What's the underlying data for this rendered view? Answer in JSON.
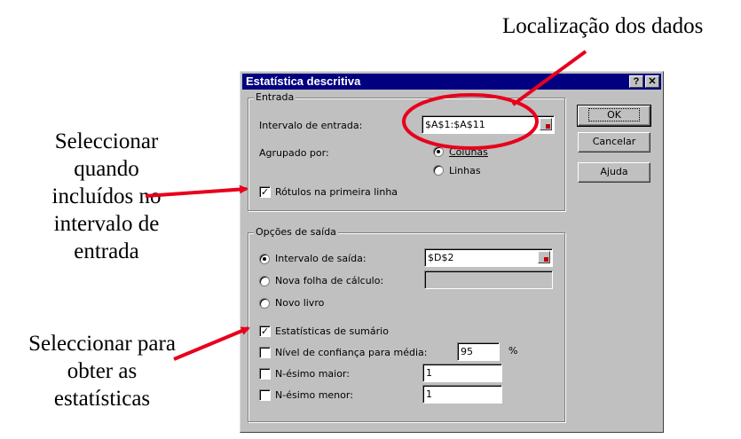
{
  "annotations": {
    "data_location": "Localização dos dados",
    "select_labels": [
      "Seleccionar",
      "quando",
      "incluídos no",
      "intervalo de",
      "entrada"
    ],
    "select_stats": [
      "Seleccionar para",
      "obter as",
      "estatísticas"
    ]
  },
  "dialog": {
    "title": "Estatística descritiva",
    "help_button": "?",
    "close_button": "✕",
    "input_group": {
      "label": "Entrada",
      "range_label": "Intervalo de entrada:",
      "range_value": "$A$1:$A$11",
      "grouped_label": "Agrupado por:",
      "columns_label": "Colunas",
      "rows_label": "Linhas",
      "labels_first_row": "Rótulos na primeira linha"
    },
    "output_group": {
      "label": "Opções de saída",
      "output_range_label": "Intervalo de saída:",
      "output_range_value": "$D$2",
      "new_sheet_label": "Nova folha de cálculo:",
      "new_workbook_label": "Novo livro",
      "summary_stats_label": "Estatísticas de sumário",
      "confidence_label": "Nível de confiança para média:",
      "confidence_value": "95",
      "confidence_unit": "%",
      "kth_largest_label": "N-ésimo maior:",
      "kth_largest_value": "1",
      "kth_smallest_label": "N-ésimo menor:",
      "kth_smallest_value": "1"
    },
    "buttons": {
      "ok": "OK",
      "cancel": "Cancelar",
      "help": "Ajuda"
    }
  },
  "colors": {
    "titlebar": "#000080",
    "annotation_red": "#e8001c",
    "dialog_bg": "#c0c0c0"
  }
}
